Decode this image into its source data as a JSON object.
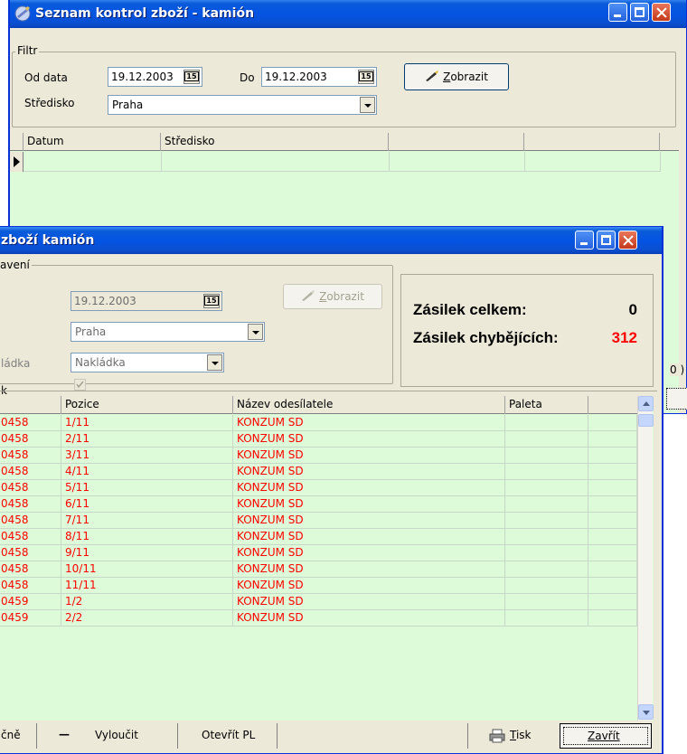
{
  "back_window": {
    "title": "Seznam kontrol zboží - kamión",
    "filter": {
      "group_title": "Filtr",
      "from_label": "Od data",
      "from_value": "19.12.2003",
      "to_label": "Do",
      "to_value": "19.12.2003",
      "center_label": "Středisko",
      "center_value": "Praha",
      "show_button": "Zobrazit",
      "show_accel": "Z",
      "show_rest": "obrazit"
    },
    "grid": {
      "columns": [
        "Datum",
        "Středisko",
        "",
        ""
      ]
    },
    "edge_text": "0 )"
  },
  "front_window": {
    "title": "zboží kamión",
    "settings": {
      "group_title": "avení",
      "date_value": "19.12.2003",
      "center_value": "Praha",
      "loading_label": "ládka",
      "loading_value": "Nakládka",
      "show_button": "Zobrazit",
      "show_accel": "Z",
      "show_rest": "obrazit"
    },
    "summary": {
      "total_label": "Zásilek celkem:",
      "total_value": "0",
      "missing_label": "Zásilek chybějících:",
      "missing_value": "312",
      "missing_color": "#ff0000"
    },
    "list_group_title": "k",
    "grid": {
      "columns": [
        "",
        "Pozice",
        "Název odesílatele",
        "Paleta"
      ],
      "rows": [
        [
          "0458",
          "1/11",
          "KONZUM SD",
          ""
        ],
        [
          "0458",
          "2/11",
          "KONZUM SD",
          ""
        ],
        [
          "0458",
          "3/11",
          "KONZUM SD",
          ""
        ],
        [
          "0458",
          "4/11",
          "KONZUM SD",
          ""
        ],
        [
          "0458",
          "5/11",
          "KONZUM SD",
          ""
        ],
        [
          "0458",
          "6/11",
          "KONZUM SD",
          ""
        ],
        [
          "0458",
          "7/11",
          "KONZUM SD",
          ""
        ],
        [
          "0458",
          "8/11",
          "KONZUM SD",
          ""
        ],
        [
          "0458",
          "9/11",
          "KONZUM SD",
          ""
        ],
        [
          "0458",
          "10/11",
          "KONZUM SD",
          ""
        ],
        [
          "0458",
          "11/11",
          "KONZUM SD",
          ""
        ],
        [
          "0459",
          "1/2",
          "KONZUM SD",
          ""
        ],
        [
          "0459",
          "2/2",
          "KONZUM SD",
          ""
        ]
      ]
    },
    "buttons": {
      "manual_partial": "čně",
      "exclude_symbol": "—",
      "exclude": "Vyloučit",
      "open_pl": "Otevřít PL",
      "print": "Tisk",
      "print_accel": "T",
      "print_rest": "isk",
      "close": "Zavřít"
    }
  },
  "colors": {
    "title_blue": "#0454e3",
    "grid_green": "#ddfbd8",
    "row_text_red": "#ff0000",
    "window_face": "#ece9d8"
  }
}
